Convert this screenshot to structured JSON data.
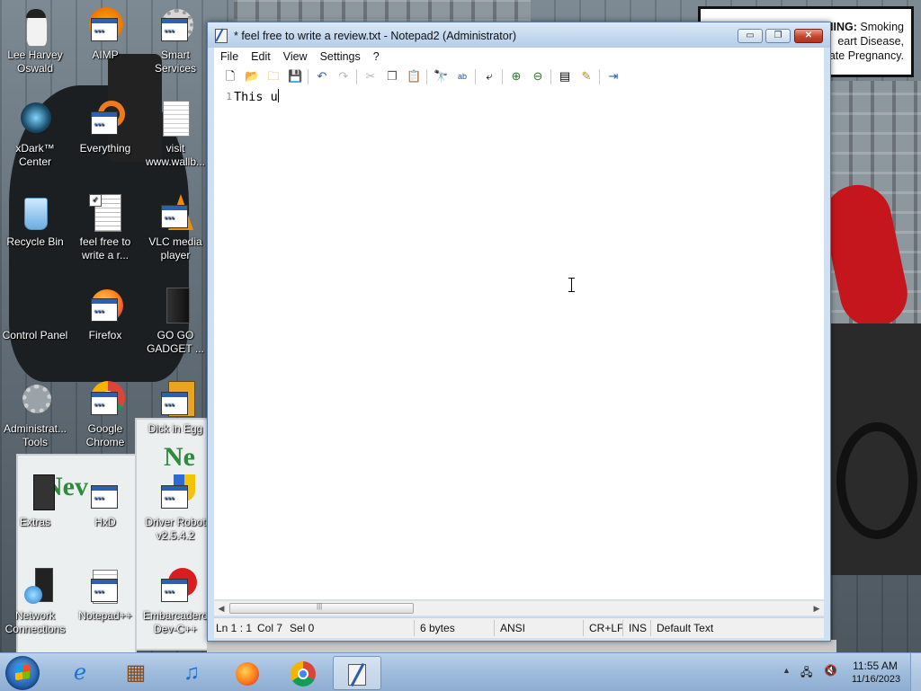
{
  "warning": {
    "bold": "NING:",
    "line1": "Smoking",
    "line2": "eart Disease,",
    "line3": "icate Pregnancy."
  },
  "desktop_icons": [
    {
      "label": "Lee Harvey Oswald"
    },
    {
      "label": "AIMP"
    },
    {
      "label": "Smart Services"
    },
    {
      "label": "xDark™ Center"
    },
    {
      "label": "Everything"
    },
    {
      "label": "visit www.wallb..."
    },
    {
      "label": "Recycle Bin"
    },
    {
      "label": "feel free to write a r..."
    },
    {
      "label": "VLC media player"
    },
    {
      "label": "Control Panel"
    },
    {
      "label": "Firefox"
    },
    {
      "label": "GO GO GADGET ..."
    },
    {
      "label": "Administrat... Tools"
    },
    {
      "label": "Google Chrome"
    },
    {
      "label": "Dick in Egg"
    },
    {
      "label": "Extras"
    },
    {
      "label": "HxD"
    },
    {
      "label": "Driver Robot v2.5.4.2"
    },
    {
      "label": "Network Connections"
    },
    {
      "label": "Notepad++"
    },
    {
      "label": "Embarcadero Dev-C++"
    }
  ],
  "window": {
    "title": "* feel free to write a review.txt - Notepad2 (Administrator)",
    "controls": {
      "minimize": "▭",
      "maximize": "❐",
      "close": "✕"
    },
    "menu": [
      "File",
      "Edit",
      "View",
      "Settings",
      "?"
    ],
    "editor": {
      "line_number": "1",
      "text": "This u"
    },
    "status": {
      "position": "Ln 1 : 1",
      "col": "Col 7",
      "sel": "Sel 0",
      "size": "6 bytes",
      "encoding": "ANSI",
      "eol": "CR+LF",
      "mode": "INS",
      "scheme": "Default Text"
    }
  },
  "taskbar": {
    "time": "11:55 AM",
    "date": "11/16/2023"
  }
}
